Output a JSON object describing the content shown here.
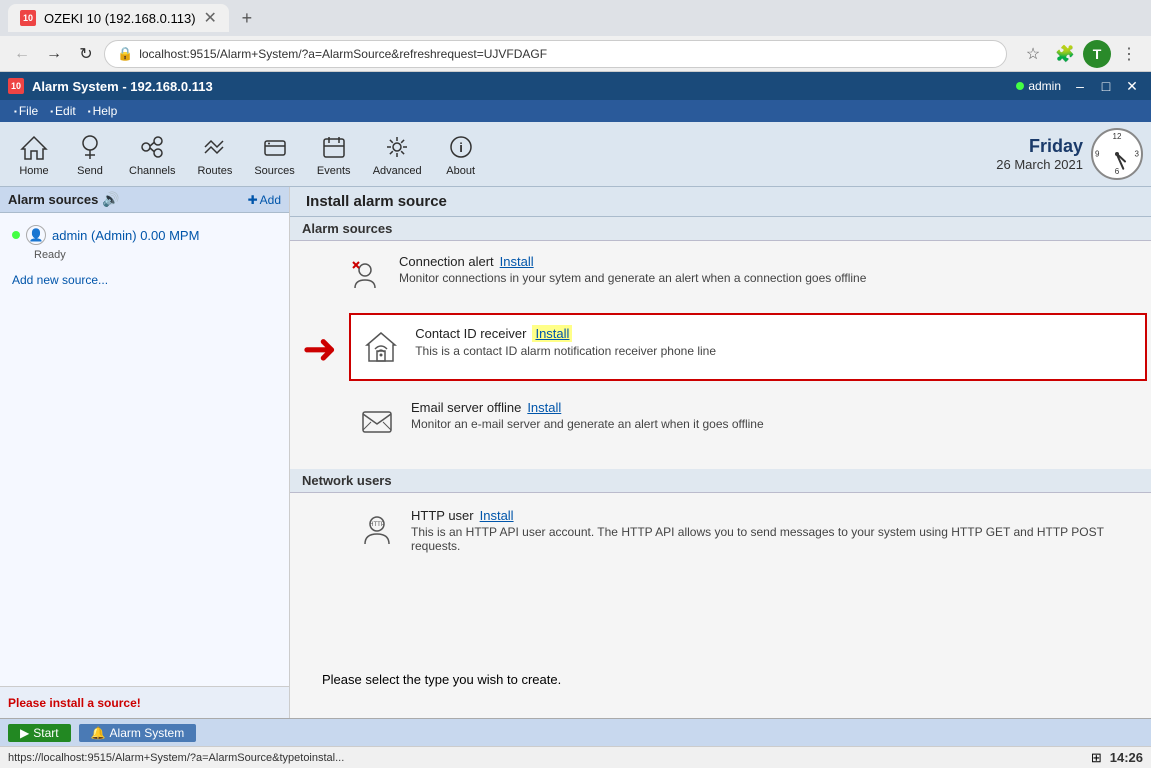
{
  "browser": {
    "tab_title": "OZEKI 10 (192.168.0.113)",
    "url": "localhost:9515/Alarm+System/?a=AlarmSource&refreshrequest=UJVFDAGF",
    "status_url": "https://localhost:9515/Alarm+System/?a=AlarmSource&typetoinstal..."
  },
  "app": {
    "title": "Alarm System - 192.168.0.113",
    "admin_label": "admin"
  },
  "menu": {
    "file": "File",
    "edit": "Edit",
    "help": "Help"
  },
  "toolbar": {
    "home_label": "Home",
    "send_label": "Send",
    "channels_label": "Channels",
    "routes_label": "Routes",
    "sources_label": "Sources",
    "events_label": "Events",
    "advanced_label": "Advanced",
    "about_label": "About"
  },
  "clock": {
    "day": "Friday",
    "date": "26 March 2021",
    "time": "14:26"
  },
  "sidebar": {
    "title": "Alarm sources",
    "add_label": "Add",
    "user_name": "admin",
    "user_role": "(Admin)",
    "user_mpm": "0.00 MPM",
    "user_status": "Ready",
    "add_source_link": "Add new source...",
    "footer_text": "Please install a source!"
  },
  "content": {
    "header": "Install alarm source",
    "sections": [
      {
        "title": "Alarm sources",
        "items": [
          {
            "name": "Connection alert",
            "install_label": "Install",
            "description": "Monitor connections in your sytem and generate an alert when a connection goes offline",
            "highlighted": false
          },
          {
            "name": "Contact ID receiver",
            "install_label": "Install",
            "description": "This is a contact ID alarm notification receiver phone line",
            "highlighted": true
          },
          {
            "name": "Email server offline",
            "install_label": "Install",
            "description": "Monitor an e-mail server and generate an alert when it goes offline",
            "highlighted": false
          }
        ]
      },
      {
        "title": "Network users",
        "items": [
          {
            "name": "HTTP user",
            "install_label": "Install",
            "description": "This is an HTTP API user account. The HTTP API allows you to send messages to your system using HTTP GET and HTTP POST requests.",
            "highlighted": false
          }
        ]
      }
    ],
    "footer_text": "Please select the type you wish to create."
  },
  "taskbar": {
    "time": "14:26"
  }
}
